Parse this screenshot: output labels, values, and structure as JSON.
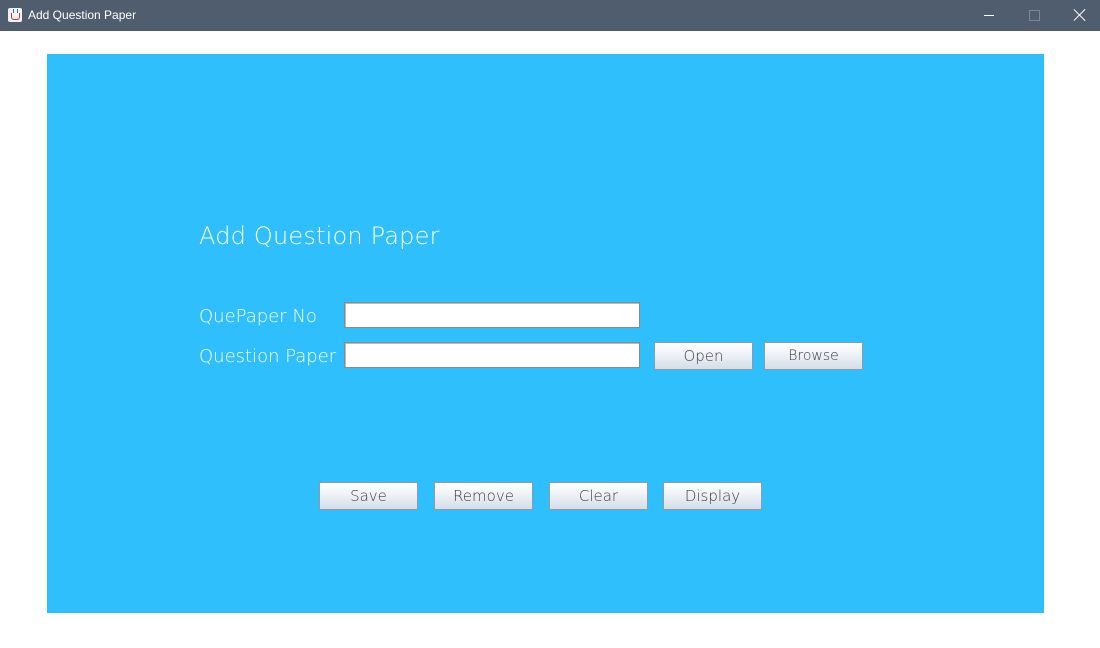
{
  "window": {
    "title": "Add Question Paper",
    "icon": "java-cup-icon",
    "controls": [
      "minimize",
      "maximize",
      "close"
    ]
  },
  "form": {
    "heading": "Add Question Paper",
    "fields": [
      {
        "label": "QuePaper No",
        "value": "",
        "placeholder": ""
      },
      {
        "label": "Question Paper",
        "value": "",
        "placeholder": ""
      }
    ],
    "file_buttons": {
      "open_label": "Open",
      "browse_label": "Browse"
    },
    "actions": {
      "save_label": "Save",
      "remove_label": "Remove",
      "clear_label": "Clear",
      "display_label": "Display"
    }
  },
  "colors": {
    "titlebar": "#4f5d6e",
    "panel": "#2ebffc",
    "label_text": "#ffffff",
    "button_text": "#3d3d3d"
  }
}
